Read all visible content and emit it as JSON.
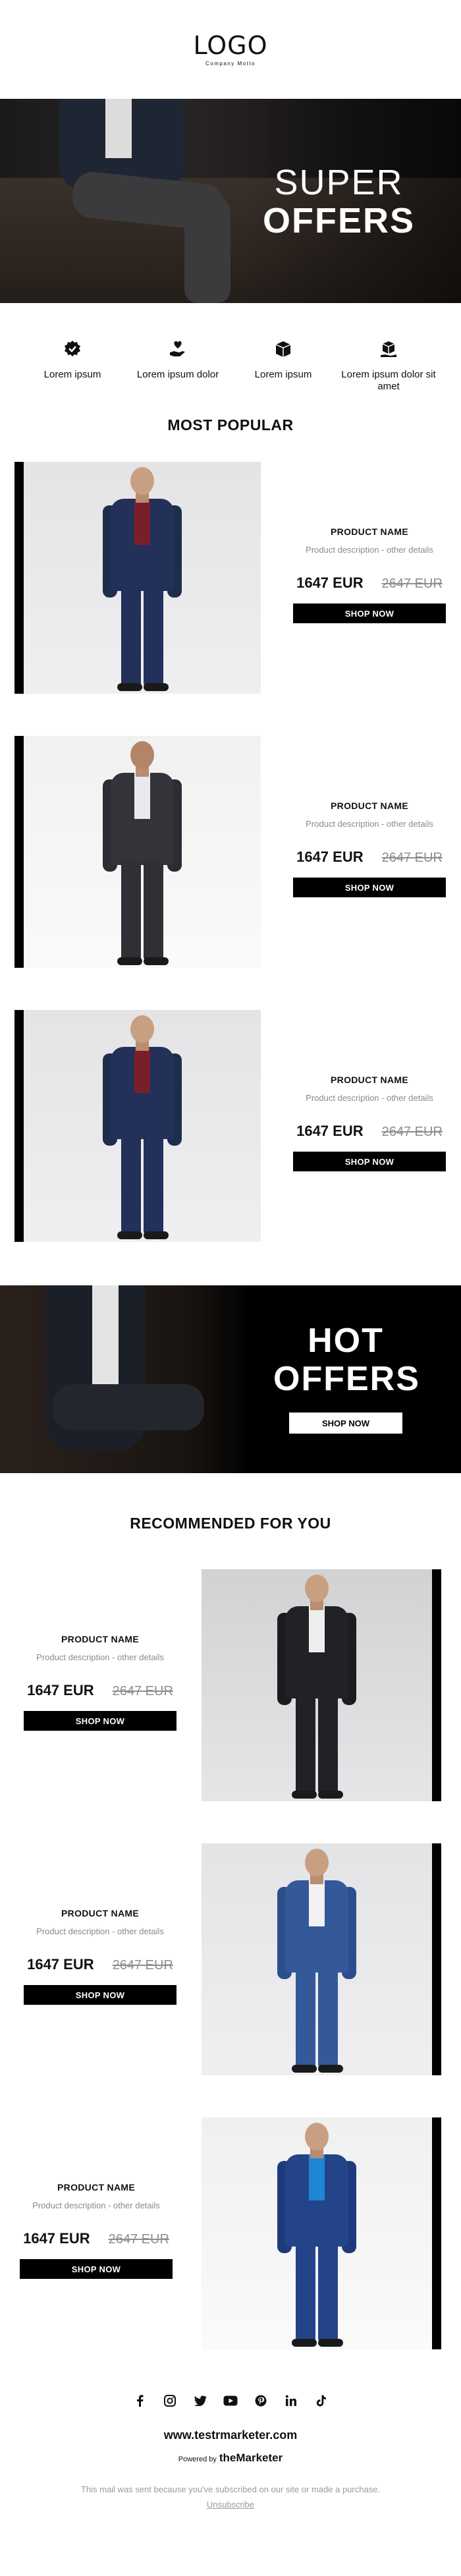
{
  "header": {
    "logo": "LOGO",
    "tagline": "Company Motto"
  },
  "hero": {
    "line1": "SUPER",
    "line2": "OFFERS"
  },
  "features": [
    {
      "icon": "badge-check-icon",
      "label": "Lorem ipsum"
    },
    {
      "icon": "hand-heart-icon",
      "label": "Lorem ipsum dolor"
    },
    {
      "icon": "boxes-icon",
      "label": "Lorem ipsum"
    },
    {
      "icon": "box-hand-icon",
      "label": "Lorem ipsum dolor sit amet"
    }
  ],
  "popular": {
    "title": "MOST POPULAR",
    "products": [
      {
        "name": "PRODUCT NAME",
        "desc": "Product description - other details",
        "price": "1647 EUR",
        "old_price": "2647 EUR",
        "cta": "SHOP NOW"
      },
      {
        "name": "PRODUCT NAME",
        "desc": "Product description - other details",
        "price": "1647 EUR",
        "old_price": "2647 EUR",
        "cta": "SHOP NOW"
      },
      {
        "name": "PRODUCT NAME",
        "desc": "Product description - other details",
        "price": "1647 EUR",
        "old_price": "2647 EUR",
        "cta": "SHOP NOW"
      }
    ]
  },
  "hot": {
    "line1": "HOT",
    "line2": "OFFERS",
    "cta": "SHOP NOW"
  },
  "recommended": {
    "title": "RECOMMENDED FOR YOU",
    "products": [
      {
        "name": "PRODUCT NAME",
        "desc": "Product description - other details",
        "price": "1647 EUR",
        "old_price": "2647 EUR",
        "cta": "SHOP NOW"
      },
      {
        "name": "PRODUCT NAME",
        "desc": "Product description - other details",
        "price": "1647 EUR",
        "old_price": "2647 EUR",
        "cta": "SHOP NOW"
      },
      {
        "name": "PRODUCT NAME",
        "desc": "Product description - other details",
        "price": "1647 EUR",
        "old_price": "2647 EUR",
        "cta": "SHOP NOW"
      }
    ]
  },
  "footer": {
    "socials": [
      "facebook-icon",
      "instagram-icon",
      "twitter-icon",
      "youtube-icon",
      "pinterest-icon",
      "linkedin-icon",
      "tiktok-icon"
    ],
    "website": "www.testrmarketer.com",
    "powered_label": "Powered by",
    "powered_brand": "theMarketer",
    "note": "This mail was sent because you've subscribed on our site or made a purchase.",
    "unsubscribe": "Unsubscribe"
  }
}
